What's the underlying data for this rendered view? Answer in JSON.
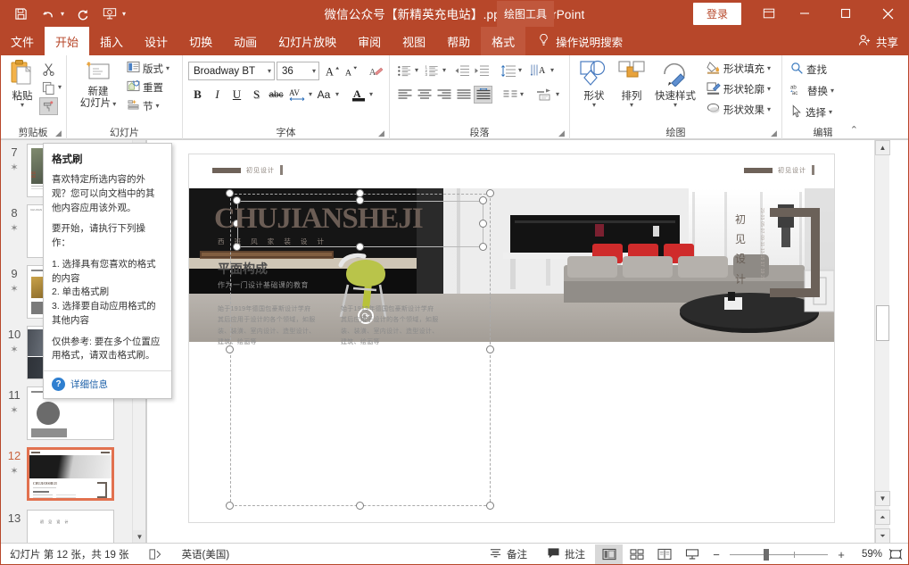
{
  "titlebar": {
    "document_title": "微信公众号【新精英充电站】.pptx  -  PowerPoint",
    "qat": [
      {
        "name": "save-icon",
        "glyph": "save"
      },
      {
        "name": "undo-icon",
        "glyph": "undo"
      },
      {
        "name": "redo-icon",
        "glyph": "redo"
      },
      {
        "name": "start-slideshow-icon",
        "glyph": "slideshow"
      },
      {
        "name": "customize-qat-icon",
        "glyph": "caret"
      }
    ],
    "drawing_tools_label": "绘图工具",
    "signin_label": "登录",
    "ribbon_display_label": "功能区显示选项",
    "minimize_label": "—",
    "maximize_label": "□",
    "close_label": "✕"
  },
  "tabs": [
    {
      "label": "文件",
      "state": "file"
    },
    {
      "label": "开始",
      "state": "active"
    },
    {
      "label": "插入",
      "state": "normal"
    },
    {
      "label": "设计",
      "state": "normal"
    },
    {
      "label": "切换",
      "state": "normal"
    },
    {
      "label": "动画",
      "state": "normal"
    },
    {
      "label": "幻灯片放映",
      "state": "normal"
    },
    {
      "label": "审阅",
      "state": "normal"
    },
    {
      "label": "视图",
      "state": "normal"
    },
    {
      "label": "帮助",
      "state": "normal"
    },
    {
      "label": "格式",
      "state": "format-active"
    }
  ],
  "tell_me": "操作说明搜索",
  "share": "共享",
  "ribbon": {
    "clipboard": {
      "group_label": "剪贴板",
      "paste_label": "粘贴",
      "cut_label": "剪切",
      "copy_label": "复制",
      "format_painter_label": "格式刷"
    },
    "slides": {
      "group_label": "幻灯片",
      "new_slide_label": "新建\n幻灯片",
      "new_slide_line1": "新建",
      "new_slide_line2": "幻灯片",
      "layout_label": "版式",
      "reset_label": "重置",
      "section_label": "节"
    },
    "font": {
      "group_label": "字体",
      "font_name": "Broadway BT",
      "font_size": "36",
      "grow_font": "A",
      "shrink_font": "A",
      "clear_formatting": "清除所有格式",
      "bold": "B",
      "italic": "I",
      "underline": "U",
      "shadow": "S",
      "strikethrough": "abc",
      "char_spacing": "AV",
      "change_case": "Aa",
      "font_color": "A"
    },
    "paragraph": {
      "group_label": "段落",
      "bullets": "项目符号",
      "numbering": "编号",
      "decrease_indent": "减少缩进量",
      "increase_indent": "增加缩进量",
      "line_spacing": "行距",
      "text_direction": "文字方向",
      "align_left": "左对齐",
      "align_center": "居中",
      "align_right": "右对齐",
      "justify": "两端对齐",
      "distributed": "分散对齐",
      "columns": "分栏",
      "align_text": "对齐文本",
      "smartart": "转换为 SmartArt"
    },
    "drawing": {
      "group_label": "绘图",
      "shapes_label": "形状",
      "arrange_label": "排列",
      "quick_styles_label": "快速样式",
      "shape_fill_label": "形状填充",
      "shape_outline_label": "形状轮廓",
      "shape_effects_label": "形状效果"
    },
    "editing": {
      "group_label": "编辑",
      "find_label": "查找",
      "replace_label": "替换",
      "select_label": "选择"
    }
  },
  "tooltip": {
    "title": "格式刷",
    "paragraph1": "喜欢特定所选内容的外观？您可以向文档中的其他内容应用该外观。",
    "paragraph2": "要开始，请执行下列操作：",
    "step1": "1. 选择具有您喜欢的格式的内容",
    "step2": "2. 单击格式刷",
    "step3": "3. 选择要自动应用格式的其他内容",
    "paragraph3": "仅供参考: 要在多个位置应用格式，请双击格式刷。",
    "more_info": "详细信息"
  },
  "thumbnails": [
    {
      "number": "7",
      "starred": true,
      "selected": false
    },
    {
      "number": "8",
      "starred": true,
      "selected": false
    },
    {
      "number": "9",
      "starred": true,
      "selected": false
    },
    {
      "number": "10",
      "starred": true,
      "selected": false
    },
    {
      "number": "11",
      "starred": true,
      "selected": false
    },
    {
      "number": "12",
      "starred": true,
      "selected": true
    },
    {
      "number": "13",
      "starred": false,
      "selected": false
    }
  ],
  "slide": {
    "header_text": "初见设计",
    "header_text_right": "初见设计",
    "big_title": "CHUJIANSHEJI",
    "subtitle": "西 班 风 家 装 设 计",
    "section_title": "平面构成",
    "section_sub": "作为一门设计基础课的教育",
    "body_left": "始于1919年德国包豪斯设计学府 其后应用于设计的各个领域，如服装、装潢、室内设计、造型设计、建筑、绘画等",
    "body_right": "始于1919年德国包豪斯设计学府 其后应用于设计的各个领域，如服装、装潢、室内设计、造型设计、建筑、绘画等",
    "right_vertical": "初见设计",
    "right_micro": "29 03 05 07 09 11 13 15 17 19 21"
  },
  "statusbar": {
    "slide_count_text": "幻灯片 第 12 张，共 19 张",
    "accessibility_label": "辅助功能",
    "language": "英语(美国)",
    "notes_label": "备注",
    "comments_label": "批注",
    "view_normal": "普通视图",
    "view_sorter": "幻灯片浏览",
    "view_reading": "阅读视图",
    "view_slideshow": "幻灯片放映",
    "zoom_out": "−",
    "zoom_in": "+",
    "zoom_value": "59%",
    "fit_slide": "使幻灯片适应当前窗口"
  },
  "colors": {
    "brand": "#b7472a",
    "brand_light": "#c0573c",
    "selection": "#e2714f",
    "slide_accent": "#6b6159"
  }
}
